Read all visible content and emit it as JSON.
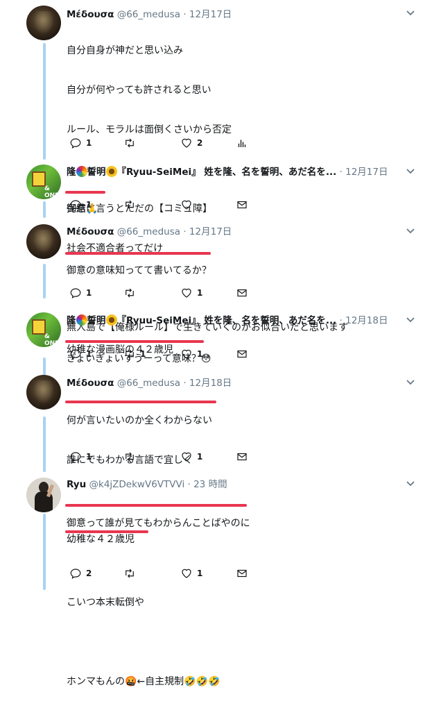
{
  "tweets": [
    {
      "name": "Μέδουσα",
      "handle": "@66_medusa",
      "dot": "·",
      "time": "12月17日",
      "lines": [
        "自分自身が神だと思い込み",
        "自分が何やっても許されると思い",
        "ルール、モラルは面倒くさいから否定",
        "",
        "完結に言うとただの【コミュ障】",
        "社会不適合者ってだけ",
        "",
        "無人島で【俺様ルール】で生きていくのがお似合いだと思います"
      ],
      "reply_count": "1",
      "retweet_count": "",
      "like_count": "2"
    },
    {
      "name": "隆",
      "name_rest": "誓明",
      "name_tail": "『Ryuu-SeiMei』 姓を隆、名を誓明、あだ名を...",
      "dot": "·",
      "time": "12月17日",
      "lines": [
        "御意🙏"
      ],
      "reply_count": "1",
      "retweet_count": "",
      "like_count": ""
    },
    {
      "name": "Μέδουσα",
      "handle": "@66_medusa",
      "dot": "·",
      "time": "12月17日",
      "lines": [
        "御意の意味知ってて書いてるか？",
        "",
        "幼稚な漫画脳の４２歳児"
      ],
      "reply_count": "1",
      "retweet_count": "",
      "like_count": "1"
    },
    {
      "name": "隆",
      "name_rest": "誓明",
      "name_tail": "『Ryuu-SeiMei』 姓を隆、名を誓明、あだ名を...",
      "dot": "·",
      "time": "12月18日",
      "lines": [
        "ぎょいぎょいすうーって意味？😳"
      ],
      "reply_count": "1",
      "retweet_count": "1",
      "like_count": "1"
    },
    {
      "name": "Μέδουσα",
      "handle": "@66_medusa",
      "dot": "·",
      "time": "12月18日",
      "lines": [
        "何が言いたいのか全くわからない",
        "誰にでもわかる言語で宜しく",
        "",
        "幼稚な４２歳児"
      ],
      "reply_count": "1",
      "retweet_count": "",
      "like_count": "1"
    },
    {
      "name": "Ryu",
      "handle": "@k4jZDekwV6VTVVi",
      "dot": "·",
      "time": "23 時間",
      "lines": [
        "御意って誰が見てもわからんことばやのに",
        "",
        "こいつ本末転倒や",
        "",
        "ホンマもんの🤬←自主規制🤣🤣🤣"
      ],
      "reply_count": "2",
      "retweet_count": "",
      "like_count": "1"
    }
  ],
  "colors": {
    "underline": "#e8364f",
    "thread": "#a9d2f3",
    "secondary": "#657786"
  },
  "icons": [
    "reply-icon",
    "retweet-icon",
    "like-icon",
    "analytics-icon",
    "dm-icon",
    "chevron-down-icon"
  ]
}
